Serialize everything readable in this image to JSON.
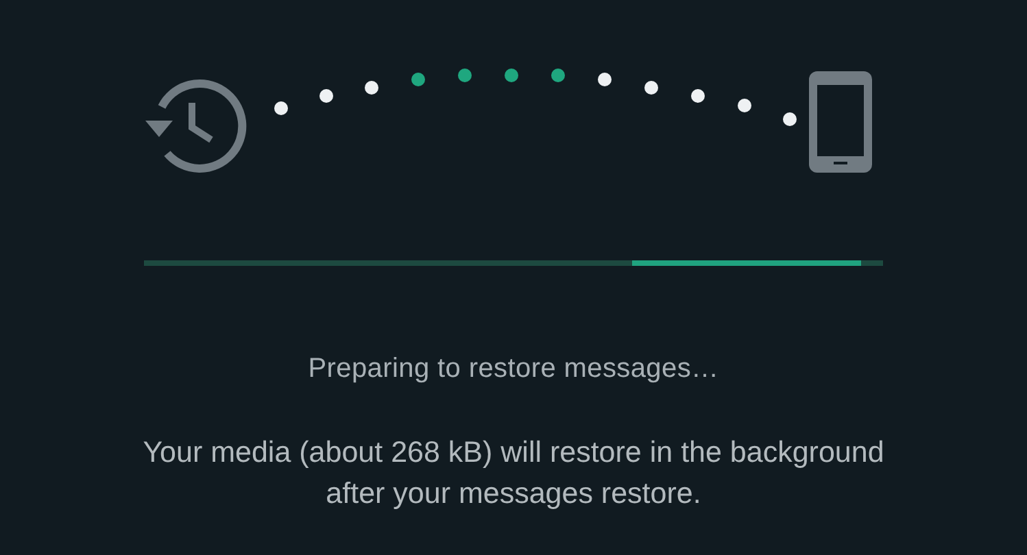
{
  "transfer_animation": {
    "dots": [
      {
        "active": false
      },
      {
        "active": false
      },
      {
        "active": false
      },
      {
        "active": true
      },
      {
        "active": true
      },
      {
        "active": true
      },
      {
        "active": true
      },
      {
        "active": false
      },
      {
        "active": false
      },
      {
        "active": false
      },
      {
        "active": false
      },
      {
        "active": false
      }
    ]
  },
  "progress_bar": {
    "level": 0.97
  },
  "status": "Preparing to restore messages…",
  "note": "Your media (about 268 kB) will restore in the background after your messages restore."
}
